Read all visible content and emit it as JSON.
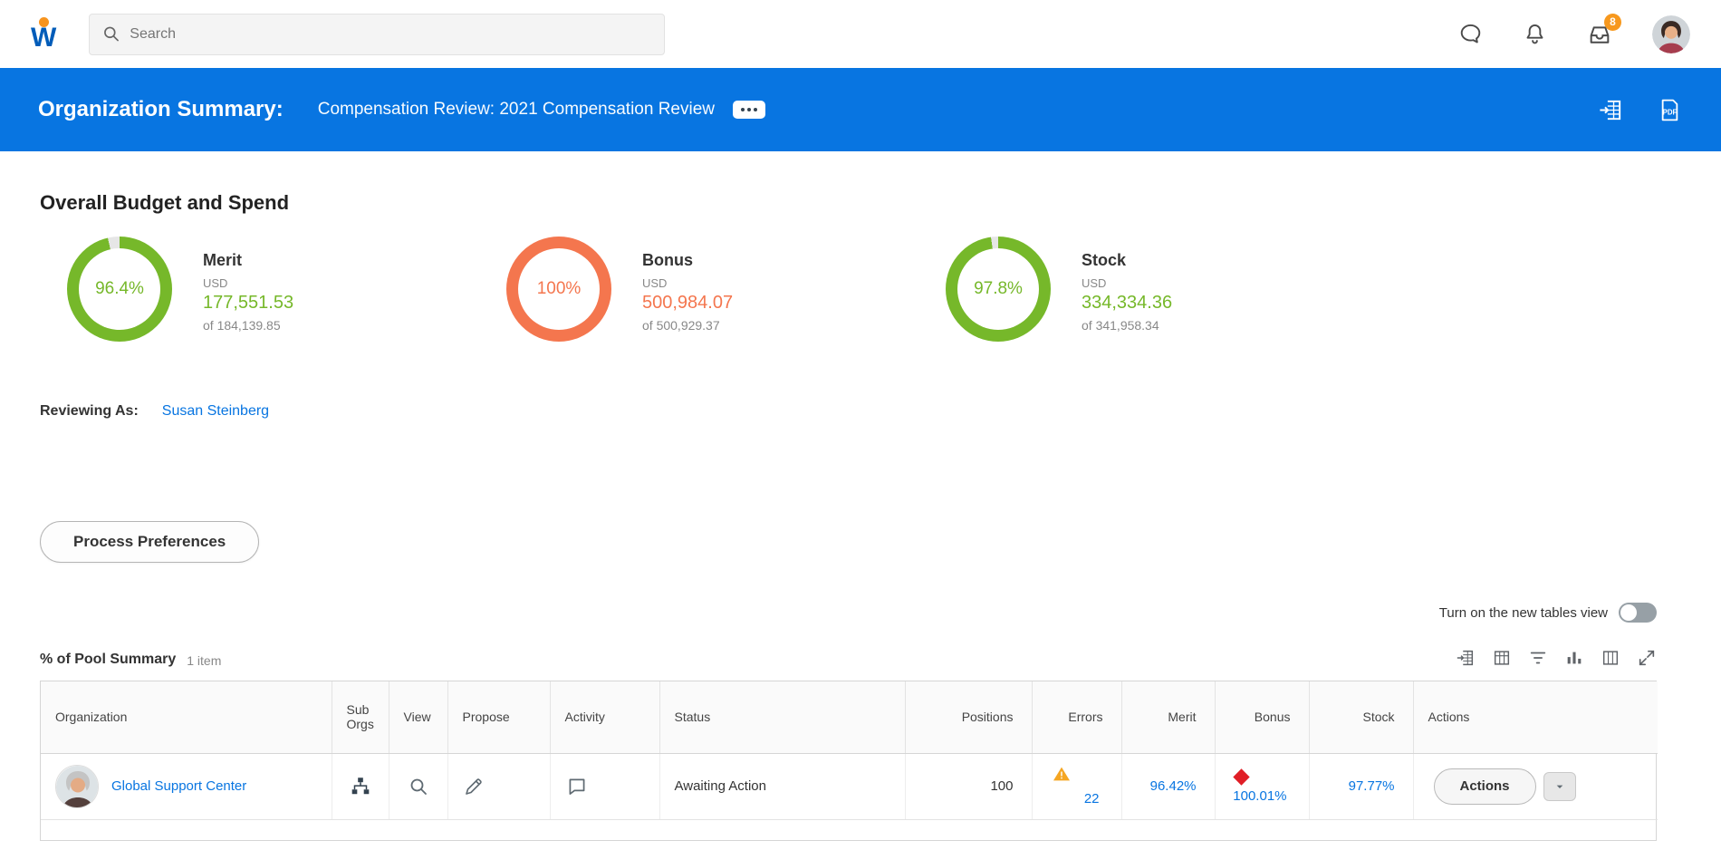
{
  "topbar": {
    "logo_letter": "W",
    "search_placeholder": "Search",
    "inbox_badge": "8"
  },
  "header": {
    "title": "Organization Summary:",
    "subtitle": "Compensation Review: 2021 Compensation Review",
    "pdf_icon_label": "PDF"
  },
  "budget": {
    "heading": "Overall Budget and Spend",
    "donuts": [
      {
        "label": "Merit",
        "percent": 96.4,
        "percent_text": "96.4%",
        "currency": "USD",
        "amount": "177,551.53",
        "of_text": "of 184,139.85",
        "color": "#76b82a"
      },
      {
        "label": "Bonus",
        "percent": 100,
        "percent_text": "100%",
        "currency": "USD",
        "amount": "500,984.07",
        "of_text": "of 500,929.37",
        "color": "#f4764e"
      },
      {
        "label": "Stock",
        "percent": 97.8,
        "percent_text": "97.8%",
        "currency": "USD",
        "amount": "334,334.36",
        "of_text": "of 341,958.34",
        "color": "#76b82a"
      }
    ]
  },
  "reviewing": {
    "label": "Reviewing As:",
    "value": "Susan Steinberg"
  },
  "buttons": {
    "process_preferences": "Process Preferences"
  },
  "tables_toggle": {
    "label": "Turn on the new tables view",
    "state": "off"
  },
  "pool_summary": {
    "title": "% of Pool Summary",
    "item_count": "1 item",
    "columns": {
      "organization": "Organization",
      "sub_orgs": "Sub Orgs",
      "view": "View",
      "propose": "Propose",
      "activity": "Activity",
      "status": "Status",
      "positions": "Positions",
      "errors": "Errors",
      "merit": "Merit",
      "bonus": "Bonus",
      "stock": "Stock",
      "actions": "Actions"
    },
    "rows": [
      {
        "organization": "Global Support Center",
        "status": "Awaiting Action",
        "positions": "100",
        "errors_count": "22",
        "merit": "96.42%",
        "bonus": "100.01%",
        "stock": "97.77%",
        "actions_label": "Actions"
      }
    ]
  }
}
